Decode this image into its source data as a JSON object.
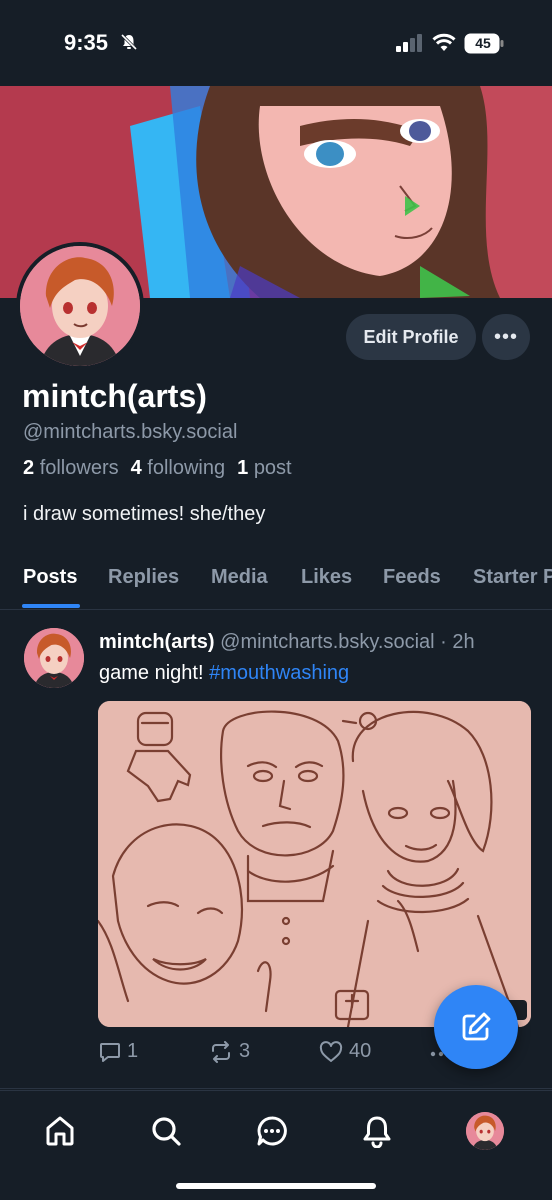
{
  "status_bar": {
    "time": "9:35",
    "battery": "45"
  },
  "profile": {
    "display_name": "mintch(arts)",
    "handle": "@mintcharts.bsky.social",
    "followers_count": "2",
    "followers_label": "followers",
    "following_count": "4",
    "following_label": "following",
    "posts_count": "1",
    "posts_label": "post",
    "bio": "i draw sometimes! she/they",
    "edit_label": "Edit Profile",
    "more_label": "•••"
  },
  "tabs": [
    "Posts",
    "Replies",
    "Media",
    "Likes",
    "Feeds",
    "Starter Packs"
  ],
  "active_tab": "Posts",
  "post": {
    "author": "mintch(arts)",
    "handle": "@mintcharts.bsky.social",
    "separator": "·",
    "time": "2h",
    "text": "game night! ",
    "hashtag": "#mouthwashing",
    "replies": "1",
    "reposts": "3",
    "likes": "40"
  },
  "icons": {
    "nav": [
      "home-icon",
      "search-icon",
      "chat-icon",
      "bell-icon",
      "profile-avatar"
    ],
    "compose": "compose-icon"
  },
  "colors": {
    "background": "#161e27",
    "accent": "#2f85f6",
    "muted": "#8d99a8",
    "button": "#2b3644"
  }
}
